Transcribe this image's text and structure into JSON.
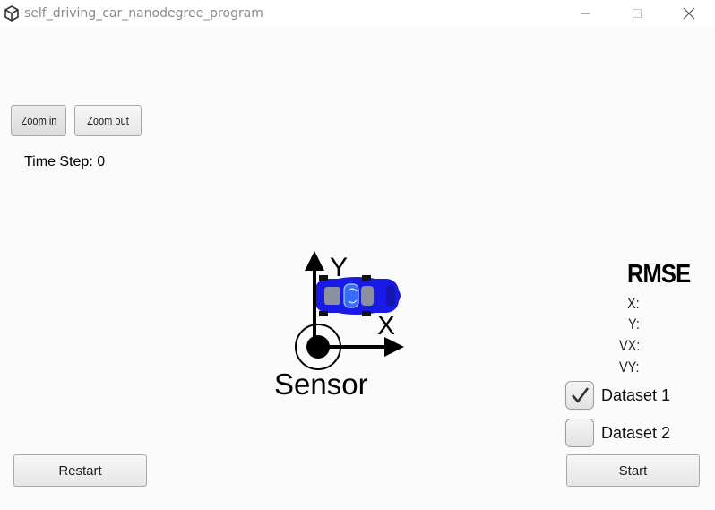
{
  "window": {
    "title": "self_driving_car_nanodegree_program",
    "app_icon": "unity-logo-icon"
  },
  "toolbar": {
    "zoom_in_label": "Zoom in",
    "zoom_out_label": "Zoom out"
  },
  "status": {
    "time_step_label": "Time Step: ",
    "time_step_value": "0"
  },
  "scene": {
    "y_axis_label": "Y",
    "x_axis_label": "X",
    "sensor_label": "Sensor",
    "car_color": "#1717e8"
  },
  "rmse": {
    "title": "RMSE",
    "x_label": "X:",
    "y_label": "Y:",
    "vx_label": "VX:",
    "vy_label": "VY:"
  },
  "datasets": [
    {
      "label": "Dataset 1",
      "checked": true
    },
    {
      "label": "Dataset 2",
      "checked": false
    }
  ],
  "controls": {
    "restart_label": "Restart",
    "start_label": "Start"
  }
}
